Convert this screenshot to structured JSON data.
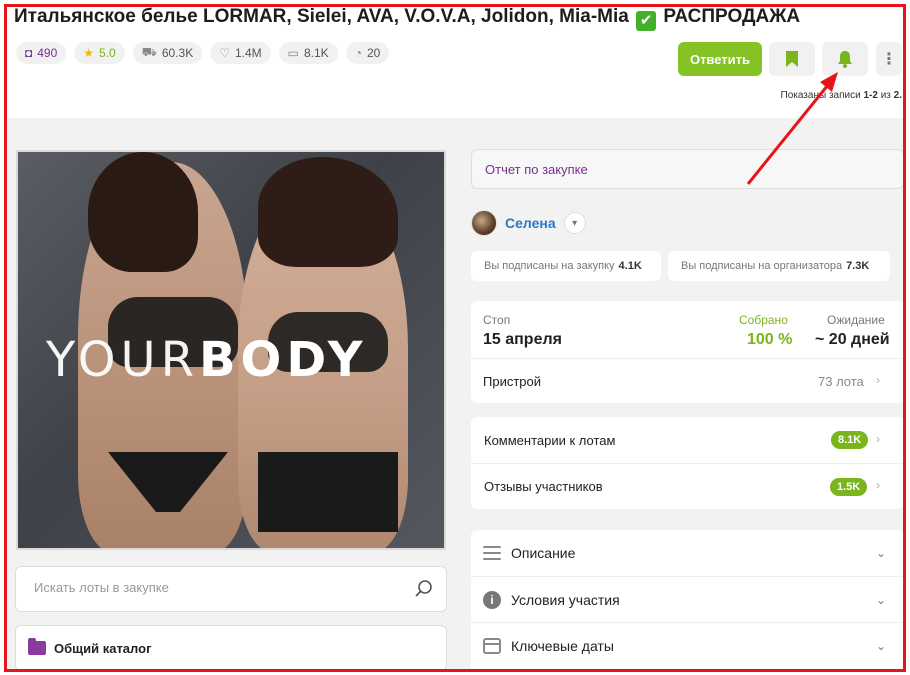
{
  "header": {
    "title": "Итальянское белье LORMAR, Sielei, AVA, V.O.V.A, Jolidon, Mia-Mia",
    "title_suffix": "РАСПРОДАЖА",
    "check_icon": "✔"
  },
  "stats": [
    {
      "icon": "bookmark-icon",
      "glyph": "◘",
      "value": "490"
    },
    {
      "icon": "star-icon",
      "glyph": "★",
      "value": "5.0"
    },
    {
      "icon": "cart-icon",
      "glyph": "⛟",
      "value": "60.3K"
    },
    {
      "icon": "heart-icon",
      "glyph": "♡",
      "value": "1.4M"
    },
    {
      "icon": "comment-icon",
      "glyph": "▭",
      "value": "8.1K"
    },
    {
      "icon": "clock-icon",
      "glyph": "◔",
      "value": "20"
    }
  ],
  "actions": {
    "reply_label": "Ответить",
    "bookmark_icon": "bookmark-icon",
    "bell_icon": "bell-icon",
    "more_icon": "more-icon",
    "accent": "#84c225"
  },
  "pagination": {
    "prefix": "Показаны записи",
    "range": "1-2",
    "middle": "из",
    "total": "2."
  },
  "photo": {
    "brand_light": "YOUR",
    "brand_bold": "BODY"
  },
  "search": {
    "placeholder": "Искать лоты в закупке"
  },
  "catalog": {
    "label": "Общий каталог"
  },
  "report": {
    "label": "Отчет по закупке"
  },
  "organizer": {
    "name": "Селена"
  },
  "subscriptions": {
    "purchase_label": "Вы подписаны на закупку",
    "purchase_count": "4.1K",
    "organizer_label": "Вы подписаны на организатора",
    "organizer_count": "7.3K"
  },
  "status": {
    "stop_label": "Стоп",
    "stop_value": "15 апреля",
    "collected_label": "Собрано",
    "collected_value": "100 %",
    "wait_label": "Ожидание",
    "wait_value": "~ 20 дней",
    "attach_label": "Пристрой",
    "attach_value": "73 лота"
  },
  "feedback": {
    "comments_label": "Комментарии к лотам",
    "comments_count": "8.1K",
    "reviews_label": "Отзывы участников",
    "reviews_count": "1.5K"
  },
  "info": {
    "description": "Описание",
    "conditions": "Условия участия",
    "dates": "Ключевые даты"
  }
}
